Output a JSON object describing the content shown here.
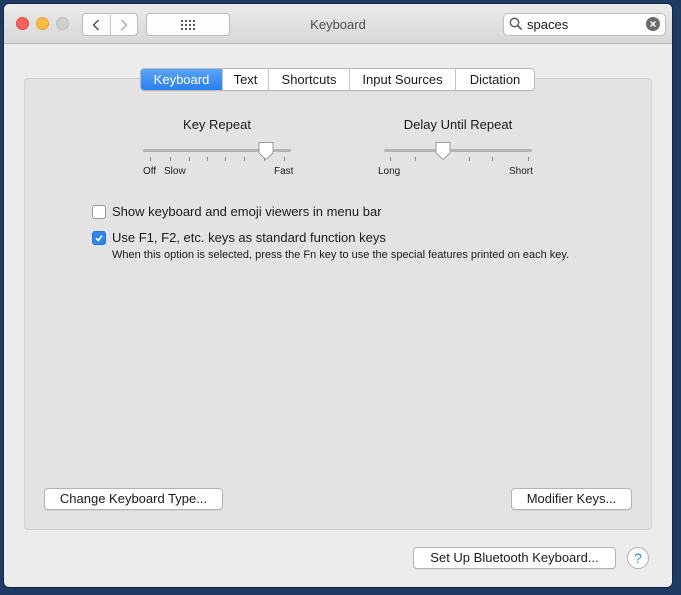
{
  "window": {
    "title": "Keyboard"
  },
  "search": {
    "value": "spaces",
    "placeholder": "Search"
  },
  "tabs": [
    {
      "label": "Keyboard",
      "active": true
    },
    {
      "label": "Text",
      "active": false
    },
    {
      "label": "Shortcuts",
      "active": false
    },
    {
      "label": "Input Sources",
      "active": false
    },
    {
      "label": "Dictation",
      "active": false
    }
  ],
  "key_repeat": {
    "label": "Key Repeat",
    "labels": {
      "off": "Off",
      "slow": "Slow",
      "fast": "Fast"
    },
    "value_fraction": 0.83
  },
  "delay_until_repeat": {
    "label": "Delay Until Repeat",
    "labels": {
      "long": "Long",
      "short": "Short"
    },
    "value_fraction": 0.4
  },
  "options": {
    "show_viewers": {
      "label": "Show keyboard and emoji viewers in menu bar",
      "checked": false
    },
    "fn_keys": {
      "label": "Use F1, F2, etc. keys as standard function keys",
      "checked": true
    },
    "fn_hint": "When this option is selected, press the Fn key to use the special features printed on each key."
  },
  "buttons": {
    "change_type": "Change Keyboard Type...",
    "modifier_keys": "Modifier Keys...",
    "bluetooth": "Set Up Bluetooth Keyboard...",
    "help": "?"
  },
  "colors": {
    "accent": "#2f86f0",
    "close": "#fc605c",
    "minimize": "#fdbc40"
  }
}
